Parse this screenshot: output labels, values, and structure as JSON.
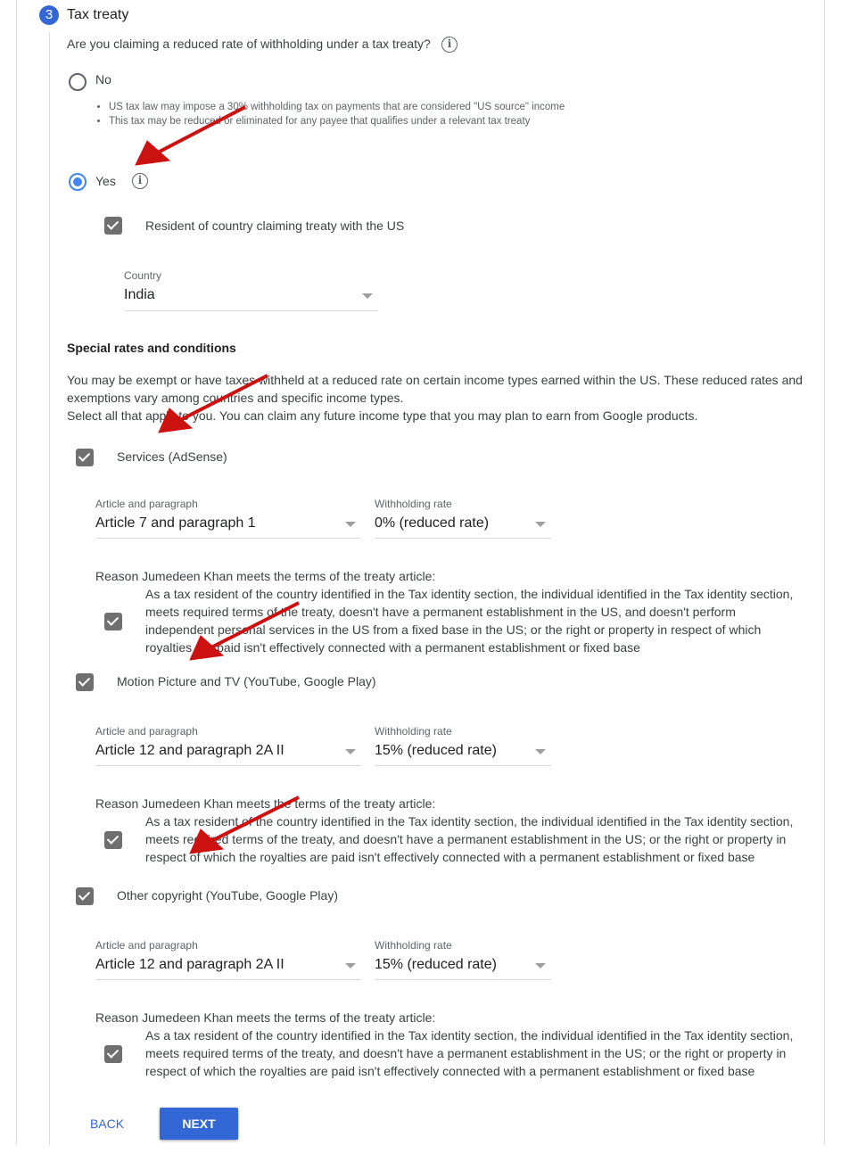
{
  "step": {
    "number": "3",
    "title": "Tax treaty",
    "question": "Are you claiming a reduced rate of withholding under a tax treaty?",
    "info_icon": "i"
  },
  "options": {
    "no": {
      "label": "No",
      "selected": false,
      "bullets": [
        "US tax law may impose a 30% withholding tax on payments that are considered \"US source\" income",
        "This tax may be reduced or eliminated for any payee that qualifies under a relevant tax treaty"
      ]
    },
    "yes": {
      "label": "Yes",
      "selected": true,
      "info_icon": "i"
    }
  },
  "resident": {
    "label": "Resident of country claiming treaty with the US",
    "checked": true
  },
  "country": {
    "label": "Country",
    "value": "India"
  },
  "special": {
    "heading": "Special rates and conditions",
    "description_line1": "You may be exempt or have taxes withheld at a reduced rate on certain income types earned within the US. These reduced rates and exemptions vary among countries and specific income types.",
    "description_line2": "Select all that apply to you. You can claim any future income type that you may plan to earn from Google products."
  },
  "income_types": [
    {
      "label": "Services (AdSense)",
      "checked": true,
      "article_label": "Article and paragraph",
      "article_value": "Article 7 and paragraph 1",
      "rate_label": "Withholding rate",
      "rate_value": "0% (reduced rate)",
      "reason_label": "Reason Jumedeen Khan meets the terms of the treaty article:",
      "reason_text": "As a tax resident of the country identified in the Tax identity section, the individual identified in the Tax identity section, meets required terms of the treaty, doesn't have a permanent establishment in the US, and doesn't perform independent personal services in the US from a fixed base in the US; or the right or property in respect of which royalties are paid isn't effectively connected with a permanent establishment or fixed base",
      "reason_checked": true
    },
    {
      "label": "Motion Picture and TV (YouTube, Google Play)",
      "checked": true,
      "article_label": "Article and paragraph",
      "article_value": "Article 12 and paragraph 2A II",
      "rate_label": "Withholding rate",
      "rate_value": "15% (reduced rate)",
      "reason_label": "Reason Jumedeen Khan meets the terms of the treaty article:",
      "reason_text": "As a tax resident of the country identified in the Tax identity section, the individual identified in the Tax identity section, meets required terms of the treaty, and doesn't have a permanent establishment in the US; or the right or property in respect of which the royalties are paid isn't effectively connected with a permanent establishment or fixed base",
      "reason_checked": true
    },
    {
      "label": "Other copyright (YouTube, Google Play)",
      "checked": true,
      "article_label": "Article and paragraph",
      "article_value": "Article 12 and paragraph 2A II",
      "rate_label": "Withholding rate",
      "rate_value": "15% (reduced rate)",
      "reason_label": "Reason Jumedeen Khan meets the terms of the treaty article:",
      "reason_text": "As a tax resident of the country identified in the Tax identity section, the individual identified in the Tax identity section, meets required terms of the treaty, and doesn't have a permanent establishment in the US; or the right or property in respect of which the royalties are paid isn't effectively connected with a permanent establishment or fixed base",
      "reason_checked": true
    }
  ],
  "buttons": {
    "back": "BACK",
    "next": "NEXT"
  },
  "colors": {
    "primary": "#3367d6",
    "radio_selected": "#4285f4",
    "checkbox": "#6f6f6f",
    "annotation_arrow": "#cc1111"
  }
}
